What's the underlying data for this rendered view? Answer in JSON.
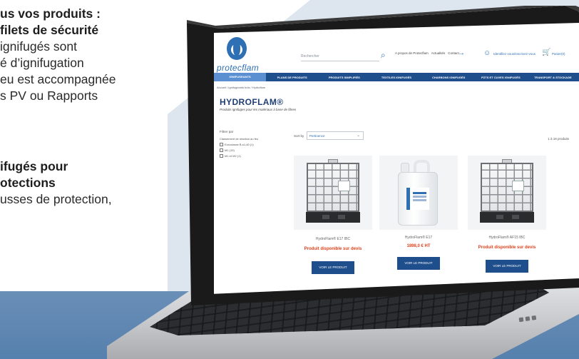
{
  "left_text": {
    "line1": "us vos produits :",
    "line2": "filets de sécurité",
    "line3": "ignifugés sont",
    "line4": "é d’ignifugation",
    "line5": "eu est accompagnée",
    "line6": "s PV ou Rapports",
    "line7": "ifugés pour",
    "line8": "otections",
    "line9": "usses de protection,"
  },
  "site": {
    "logo_text": "protecflam",
    "search_placeholder": "Rechercher",
    "header_links": [
      "A propos de Protecflam",
      "Actualités",
      "Contact"
    ],
    "account_label": "Identifiez-vous/Inscrivez-vous",
    "cart_label": "Panier(0)",
    "nav": [
      "IGNIFUGEANTS",
      "PLANS DE PRODUITS",
      "PRODUITS SIMPLIFIÉS",
      "TEXTILES IGNIFUGÉS",
      "CHARBONS IGNIFUGÉS",
      "FÛTS ET CUVES IGNIFUGÉS",
      "TRANSPORT & STOCKAGE"
    ],
    "breadcrumb": "Accueil / Ignifugeants bois / Hydroflam",
    "page_title": "HYDROFLAM®",
    "page_subtitle": "Produits ignifuges pour les matériaux à base de fibres",
    "filter_title": "Filtrer par",
    "filter_label": "Classement de réaction au feu",
    "filter_options": [
      "Euroclasse B-s1,d0 (1)",
      "M1 (19)",
      "M1 et M2 (1)"
    ],
    "sort_label": "Sort by",
    "sort_value": "Pertinence",
    "result_count": "1 à 18 produits",
    "products": [
      {
        "name": "HydroFlam® E17 IBC",
        "price": "Produit disponible sur devis",
        "button": "VOIR LE PRODUIT"
      },
      {
        "name": "HydroFlam® E17",
        "price": "1898,0 € HT",
        "button": "VOIR LE PRODUIT"
      },
      {
        "name": "HydroFlam® AF15 IBC",
        "price": "Produit disponible sur devis",
        "button": "VOIR LE PRODUIT"
      }
    ]
  }
}
